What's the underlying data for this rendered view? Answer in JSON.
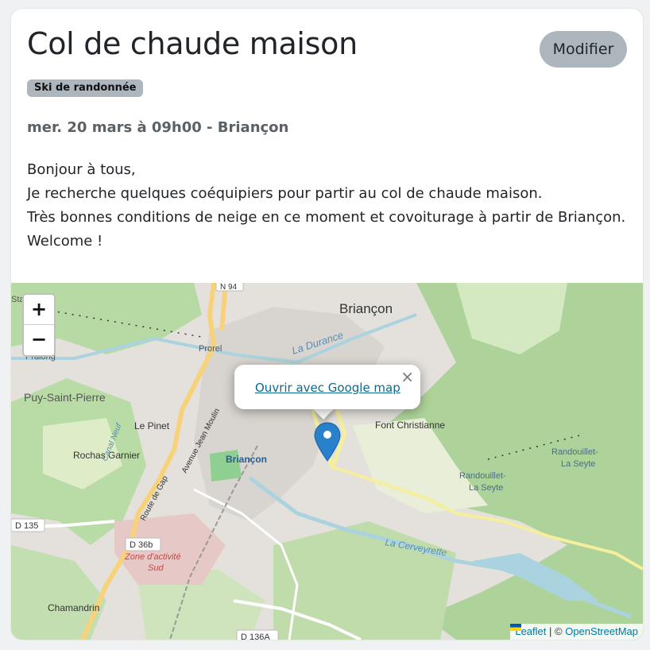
{
  "event": {
    "title": "Col de chaude maison",
    "edit_label": "Modifier",
    "activity": "Ski de randonnée",
    "meta": "mer. 20 mars à 09h00 - Briançon",
    "description_lines": [
      "Bonjour à tous,",
      "Je recherche quelques coéquipiers pour partir au col de chaude maison.",
      "Très bonnes conditions de neige en ce moment et covoiturage à partir de Briançon.",
      "Welcome !"
    ]
  },
  "map": {
    "zoom_in": "+",
    "zoom_out": "−",
    "popup_link": "Ouvrir avec Google map",
    "popup_close": "×",
    "attribution": {
      "leaflet": "Leaflet",
      "separator": "| ©",
      "osm": "OpenStreetMap"
    },
    "labels": {
      "briancon_top": "Briançon",
      "briancon_center": "Briançon",
      "la_durance": "La Durance",
      "puy_saint_pierre": "Puy-Saint-Pierre",
      "prorel": "Prorel",
      "pralong": "Pralong",
      "le_pinet": "Le Pinet",
      "rochas_garnier": "Rochas Garnier",
      "font_christianne": "Font Christianne",
      "randouillet_1": "Randouillet-",
      "randouillet_1b": "La Seyte",
      "randouillet_2": "Randouillet-",
      "randouillet_2b": "La Seyte",
      "canal_neuf": "Canal Neuf",
      "avenue_jean_moulin": "Avenue Jean Moulin",
      "route_de_gap": "Route de Gap",
      "zone_activite": "Zone d'activité",
      "zone_sud": "Sud",
      "la_cerveyrette": "La Cerveyrette",
      "chamandrin": "Chamandrin",
      "sta": "Sta",
      "road_n94": "N 94",
      "road_d135": "D 135",
      "road_d36b": "D 36b",
      "road_d136a": "D 136A"
    },
    "colors": {
      "forest": "#aed39a",
      "urban": "#dcd9d4",
      "road_main": "#f8d27a",
      "water": "#aad3df",
      "marker": "#2a81cb"
    }
  }
}
